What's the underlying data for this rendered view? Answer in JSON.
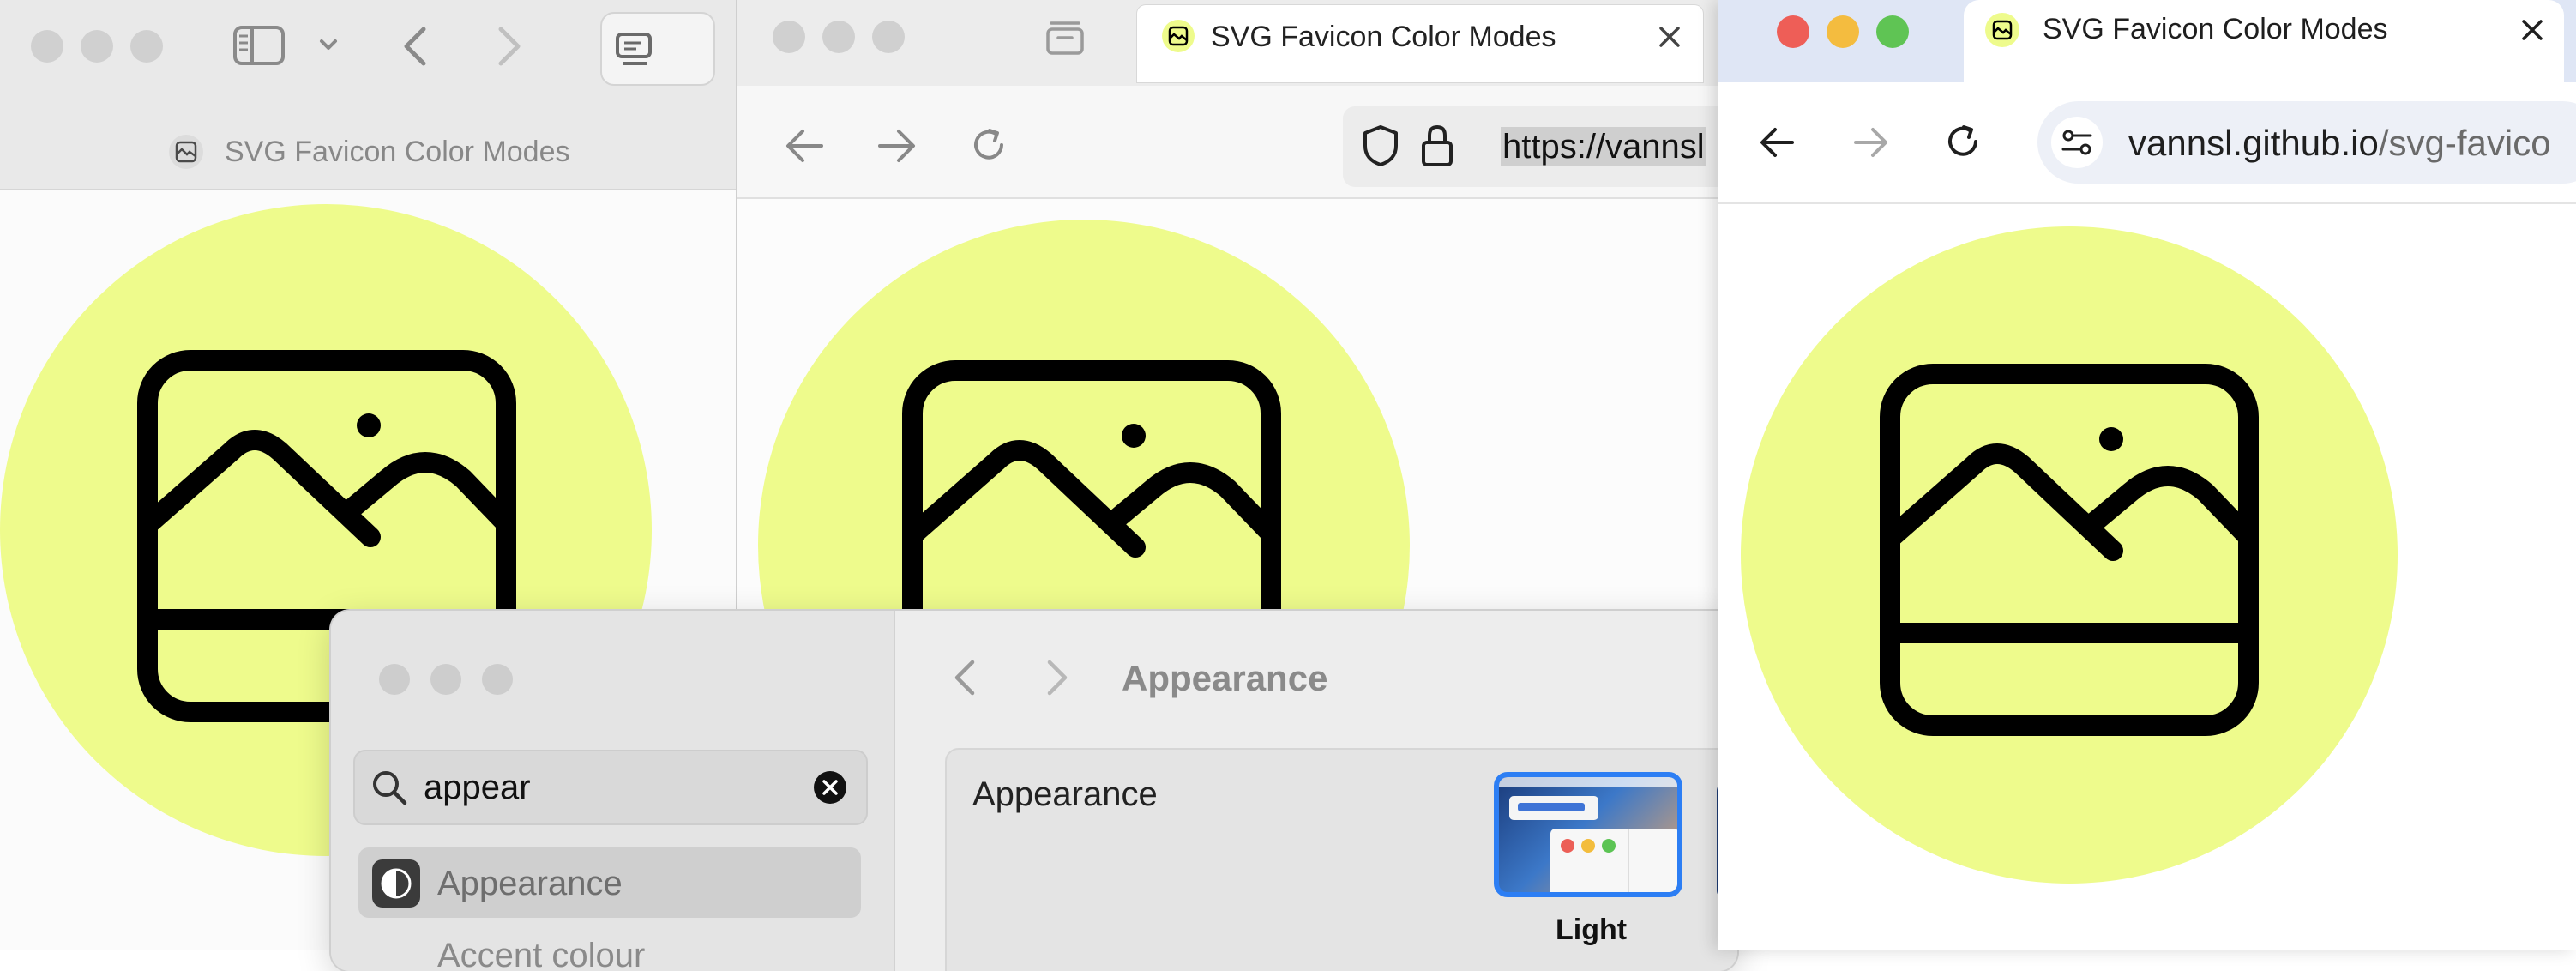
{
  "safari": {
    "page_title": "SVG Favicon Color Modes"
  },
  "firefox": {
    "tab_title": "SVG Favicon Color Modes",
    "url_text": "https://vannsl"
  },
  "chrome": {
    "tab_title": "SVG Favicon Color Modes",
    "url_host": "vannsl.github.io",
    "url_path": "/svg-favico"
  },
  "settings": {
    "search_value": "appear",
    "sidebar_selected": "Appearance",
    "sidebar_next": "Accent colour",
    "pane_title": "Appearance",
    "section_label": "Appearance",
    "theme_option_label": "Light"
  },
  "colors": {
    "favicon_circle": "#eefb8c",
    "selection_blue": "#2c7ef4"
  }
}
